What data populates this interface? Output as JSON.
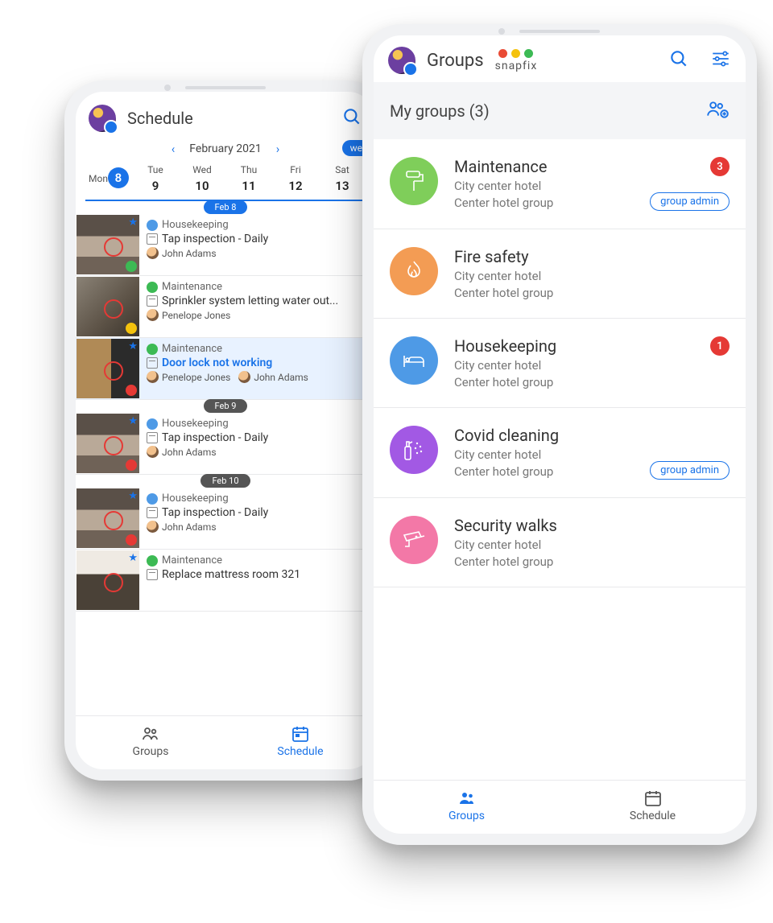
{
  "brand": {
    "name": "snapfix"
  },
  "schedule": {
    "title": "Schedule",
    "month_label": "February 2021",
    "view_toggle": "we",
    "days": [
      {
        "dow": "Mon",
        "num": "8",
        "selected": true
      },
      {
        "dow": "Tue",
        "num": "9"
      },
      {
        "dow": "Wed",
        "num": "10"
      },
      {
        "dow": "Thu",
        "num": "11"
      },
      {
        "dow": "Fri",
        "num": "12"
      },
      {
        "dow": "Sat",
        "num": "13"
      }
    ],
    "sections": [
      {
        "label": "Feb 8",
        "accent": "blue",
        "tasks": [
          {
            "thumb": "sink",
            "status": "green",
            "star": true,
            "category": "Housekeeping",
            "cat_color": "blue",
            "title": "Tap inspection - Daily",
            "assignees": [
              "John Adams"
            ]
          },
          {
            "thumb": "pipe",
            "status": "yellow",
            "star": false,
            "category": "Maintenance",
            "cat_color": "green",
            "title": "Sprinkler system letting water out...",
            "assignees": [
              "Penelope Jones"
            ]
          },
          {
            "thumb": "door",
            "status": "red",
            "star": true,
            "highlight": true,
            "category": "Maintenance",
            "cat_color": "green",
            "title": "Door lock not working",
            "title_blue": true,
            "assignees": [
              "Penelope Jones",
              "John Adams"
            ]
          }
        ]
      },
      {
        "label": "Feb 9",
        "accent": "dark",
        "tasks": [
          {
            "thumb": "sink",
            "status": "red",
            "star": true,
            "category": "Housekeeping",
            "cat_color": "blue",
            "title": "Tap inspection - Daily",
            "assignees": [
              "John Adams"
            ]
          }
        ]
      },
      {
        "label": "Feb 10",
        "accent": "dark",
        "tasks": [
          {
            "thumb": "sink",
            "status": "red",
            "star": true,
            "category": "Housekeeping",
            "cat_color": "blue",
            "title": "Tap inspection - Daily",
            "assignees": [
              "John Adams"
            ]
          },
          {
            "thumb": "room",
            "status": "",
            "star": true,
            "category": "Maintenance",
            "cat_color": "green",
            "title": "Replace mattress room 321",
            "assignees": [],
            "truncated": true
          }
        ]
      }
    ],
    "nav": {
      "groups": "Groups",
      "schedule": "Schedule",
      "active": "schedule"
    }
  },
  "groups": {
    "title": "Groups",
    "subheading": "My groups (3)",
    "items": [
      {
        "name": "Maintenance",
        "l1": "City center hotel",
        "l2": "Center hotel group",
        "icon": "roller",
        "color": "g-green",
        "badge": "3",
        "role": "group admin"
      },
      {
        "name": "Fire safety",
        "l1": "City center hotel",
        "l2": "Center hotel group",
        "icon": "fire",
        "color": "g-orange"
      },
      {
        "name": "Housekeeping",
        "l1": "City center hotel",
        "l2": "Center hotel group",
        "icon": "bed",
        "color": "g-blue",
        "badge": "1"
      },
      {
        "name": "Covid cleaning",
        "l1": "City center hotel",
        "l2": "Center hotel group",
        "icon": "spray",
        "color": "g-purple",
        "role": "group admin"
      },
      {
        "name": "Security walks",
        "l1": "City center hotel",
        "l2": "Center hotel group",
        "icon": "cctv",
        "color": "g-pink"
      }
    ],
    "nav": {
      "groups": "Groups",
      "schedule": "Schedule",
      "active": "groups"
    }
  }
}
